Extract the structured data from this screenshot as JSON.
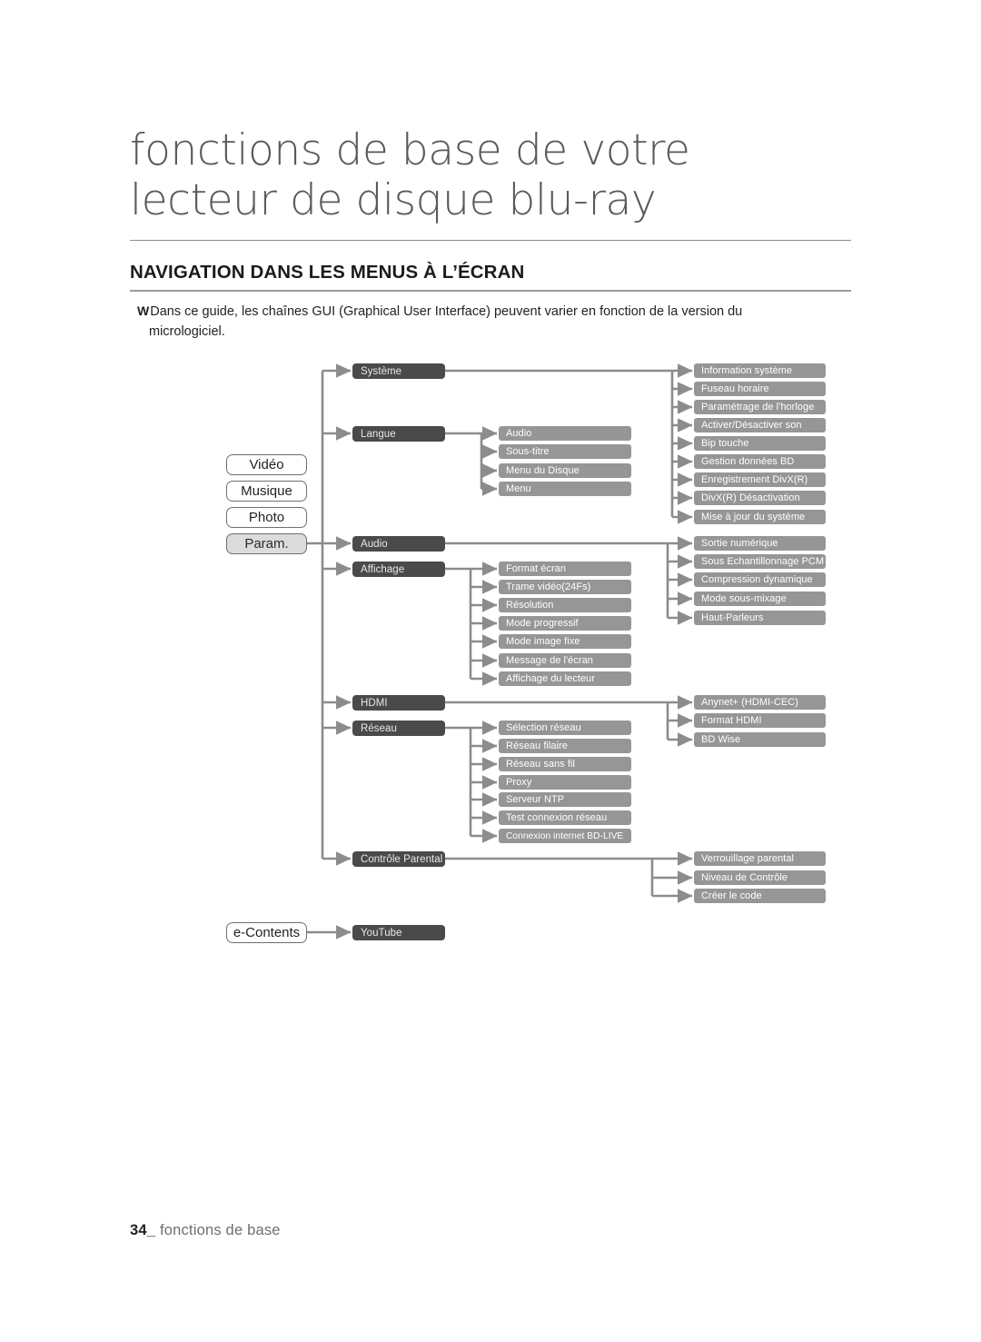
{
  "page": {
    "title_line1": "fonctions de base de votre",
    "title_line2": "lecteur de disque blu-ray",
    "section_title": "NAVIGATION DANS LES MENUS À L’ÉCRAN",
    "note_mark": "W",
    "note_text": "Dans ce guide, les chaînes GUI (Graphical User Interface) peuvent varier en fonction de la version du",
    "note_text_cont": "micrologiciel.",
    "footer_page": "34_",
    "footer_label": "fonctions de base"
  },
  "colors": {
    "level1_border": "#6f6f6f",
    "level1_selected_fill": "#dcdcdc",
    "level2_fill": "#4a4a4a",
    "level3_fill": "#969696",
    "connector": "#8c8c8c",
    "title_text": "#58595b"
  },
  "chart_data": {
    "type": "diagram",
    "title": "Arborescence des menus à l’écran",
    "level1": [
      {
        "label": "Vidéo",
        "selected": false
      },
      {
        "label": "Musique",
        "selected": false
      },
      {
        "label": "Photo",
        "selected": false
      },
      {
        "label": "Param.",
        "selected": true
      }
    ],
    "level1_extra": [
      {
        "label": "e-Contents",
        "selected": false
      }
    ],
    "branches": [
      {
        "label": "Système",
        "children": [
          "Information système",
          "Fuseau horaire",
          "Paramétrage de l'horloge",
          "Activer/Désactiver son",
          "Bip touche",
          "Gestion données BD",
          "Enregistrement DivX(R)",
          "DivX(R) Désactivation",
          "Mise à jour du système"
        ]
      },
      {
        "label": "Langue",
        "children": [
          "Audio",
          "Sous-titre",
          "Menu du Disque",
          "Menu"
        ]
      },
      {
        "label": "Audio",
        "children": [
          "Sortie numérique",
          "Sous Echantillonnage PCM",
          "Compression dynamique",
          "Mode sous-mixage",
          "Haut-Parleurs"
        ]
      },
      {
        "label": "Affichage",
        "children": [
          "Format écran",
          "Trame vidéo(24Fs)",
          "Résolution",
          "Mode progressif",
          "Mode image fixe",
          "Message de l'écran",
          "Affichage du lecteur"
        ]
      },
      {
        "label": "HDMI",
        "children": [
          "Anynet+ (HDMI-CEC)",
          "Format HDMI",
          "BD Wise"
        ]
      },
      {
        "label": "Réseau",
        "children": [
          "Sélection réseau",
          "Réseau filaire",
          "Réseau sans fil",
          "Proxy",
          "Serveur NTP",
          "Test connexion réseau",
          "Connexion internet BD-LIVE"
        ]
      },
      {
        "label": "Contrôle Parental",
        "children": [
          "Verrouillage parental",
          "Niveau de Contrôle",
          "Créer le code"
        ]
      },
      {
        "label": "YouTube",
        "children": []
      }
    ]
  }
}
